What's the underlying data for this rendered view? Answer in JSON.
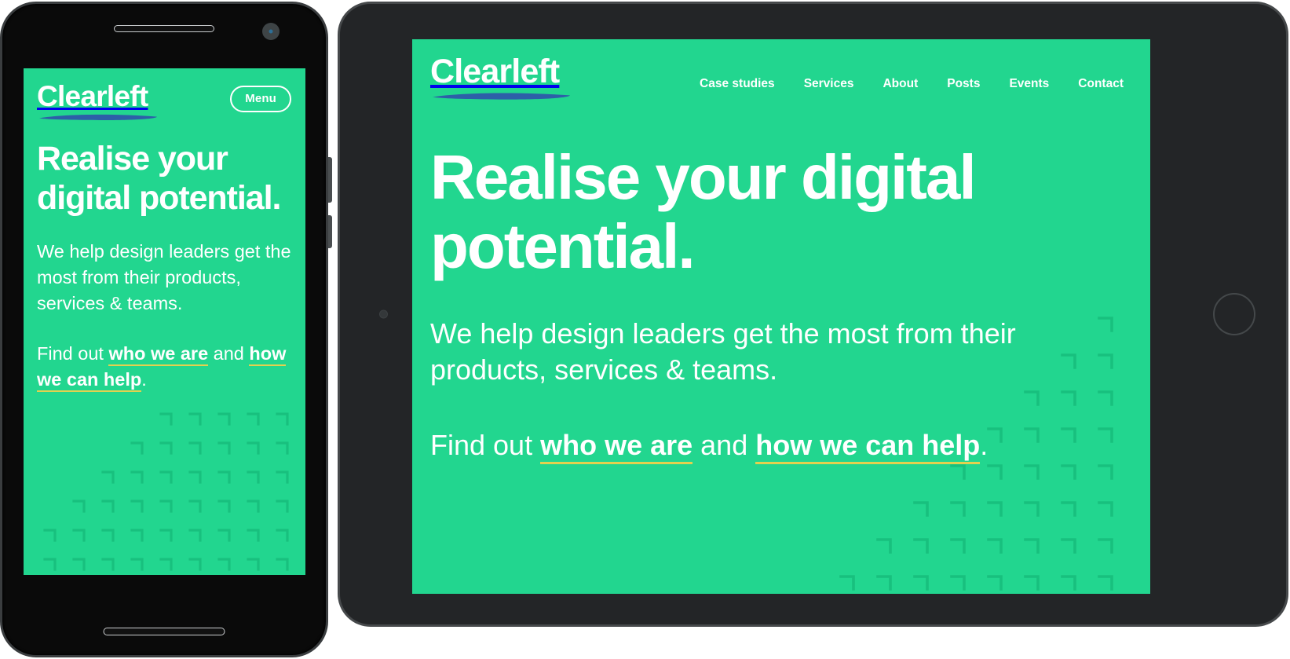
{
  "brand": {
    "name": "Clearleft",
    "green": "#22d68f",
    "underline_blue": "#2d5fa8",
    "link_yellow": "#e3d14f",
    "text_white": "#ffffff"
  },
  "phone": {
    "device_name": "smartphone-mockup",
    "logo": "Clearleft",
    "menu_label": "Menu",
    "headline": "Realise your digital potential.",
    "body": "We help design leaders get the most from their products, services & teams.",
    "find_prefix": "Find out ",
    "link_one": "who we are",
    "find_middle": " and ",
    "link_two": "how we can help",
    "find_suffix": "."
  },
  "tablet": {
    "device_name": "tablet-mockup",
    "logo": "Clearleft",
    "nav": [
      {
        "label": "Case studies"
      },
      {
        "label": "Services"
      },
      {
        "label": "About"
      },
      {
        "label": "Posts"
      },
      {
        "label": "Events"
      },
      {
        "label": "Contact"
      }
    ],
    "headline": "Realise your digital potential.",
    "body": "We help design leaders get the most from their products, services & teams.",
    "find_prefix": "Find out ",
    "link_one": "who we are",
    "find_middle": " and ",
    "link_two": "how we can help",
    "find_suffix": "."
  }
}
